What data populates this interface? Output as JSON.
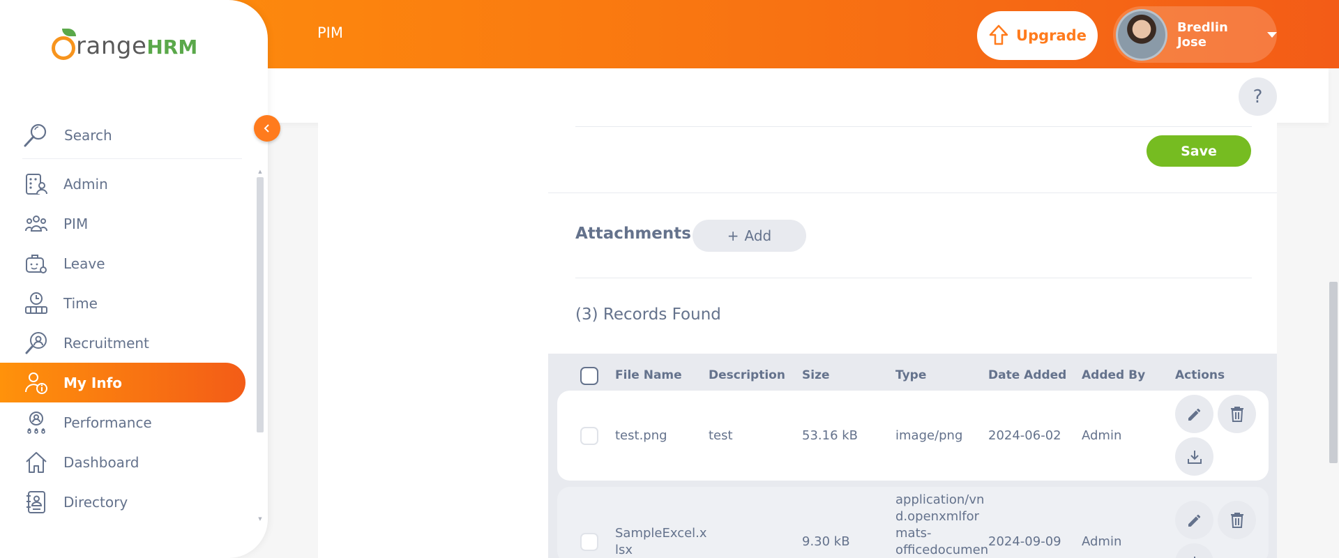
{
  "header": {
    "module_title": "PIM",
    "upgrade_label": "Upgrade",
    "user_name": "Bredlin Jose",
    "help_label": "?"
  },
  "sidebar": {
    "logo_range": "range",
    "logo_hrm": "HRM",
    "search_label": "Search",
    "items": [
      {
        "label": "Admin",
        "icon": "admin-icon"
      },
      {
        "label": "PIM",
        "icon": "pim-icon"
      },
      {
        "label": "Leave",
        "icon": "leave-icon"
      },
      {
        "label": "Time",
        "icon": "time-icon"
      },
      {
        "label": "Recruitment",
        "icon": "recruitment-icon"
      },
      {
        "label": "My Info",
        "icon": "my-info-icon",
        "active": true
      },
      {
        "label": "Performance",
        "icon": "performance-icon"
      },
      {
        "label": "Dashboard",
        "icon": "dashboard-icon"
      },
      {
        "label": "Directory",
        "icon": "directory-icon"
      }
    ]
  },
  "form": {
    "save_label": "Save"
  },
  "attachments": {
    "title": "Attachments",
    "add_label": "Add",
    "add_prefix": "+",
    "records_found": "(3) Records Found",
    "columns": [
      "File Name",
      "Description",
      "Size",
      "Type",
      "Date Added",
      "Added By",
      "Actions"
    ],
    "rows": [
      {
        "file_name": "test.png",
        "description": "test",
        "size": "53.16 kB",
        "type": "image/png",
        "date_added": "2024-06-02",
        "added_by": "Admin"
      },
      {
        "file_name_lines": [
          "SampleExcel.x",
          "lsx"
        ],
        "description": "",
        "size": "9.30 kB",
        "type_lines": [
          "application/vn",
          "d.openxmlfor",
          "mats-",
          "officedocumen"
        ],
        "date_added": "2024-09-09",
        "added_by": "Admin"
      }
    ]
  },
  "colors": {
    "brand_orange": "#ff7b1d",
    "save_green": "#76bc21",
    "text": "#64728c"
  }
}
